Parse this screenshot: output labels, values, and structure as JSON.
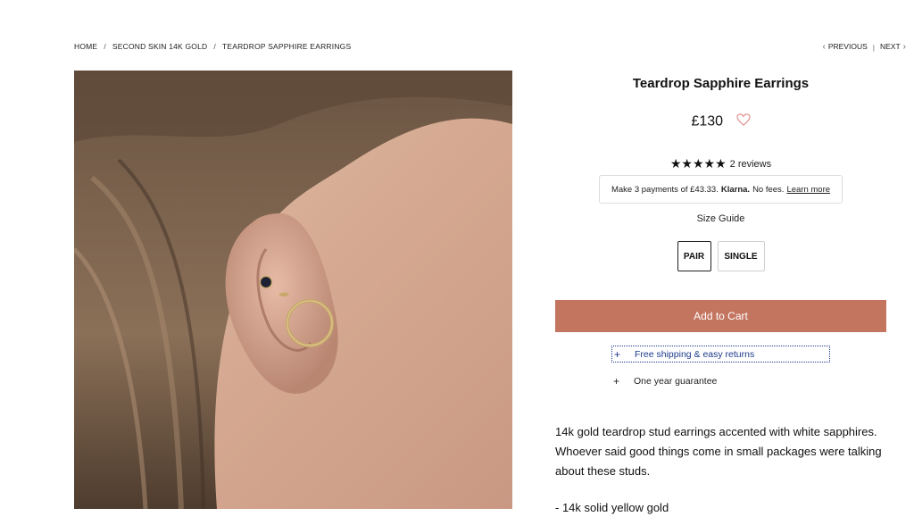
{
  "breadcrumb": {
    "items": [
      "HOME",
      "SECOND SKIN 14K GOLD",
      "TEARDROP SAPPHIRE EARRINGS"
    ],
    "separator": "/"
  },
  "pager": {
    "previous": "PREVIOUS",
    "separator": "|",
    "next": "NEXT"
  },
  "product": {
    "title": "Teardrop Sapphire Earrings",
    "price": "£130",
    "stars": "★★★★★",
    "rating": 5,
    "reviews": "2 reviews",
    "klarna": {
      "prefix": "Make 3 payments of £43.33.",
      "brand": "Klarna.",
      "suffix": "No fees.",
      "link": "Learn more"
    },
    "size_guide": "Size Guide",
    "variants": [
      "PAIR",
      "SINGLE"
    ],
    "selected_variant": "PAIR",
    "add_to_cart": "Add to Cart",
    "accordions": [
      {
        "icon": "+",
        "label": "Free shipping & easy returns"
      },
      {
        "icon": "+",
        "label": "One year guarantee"
      }
    ],
    "description": "14k gold teardrop stud earrings accented with white sapphires. Whoever said good things come in small packages were talking about these studs.",
    "bullets": [
      "- 14k solid yellow gold"
    ]
  },
  "colors": {
    "accent": "#c47560",
    "heart": "#e58f8f",
    "focus_outline": "#1d3a8a"
  }
}
